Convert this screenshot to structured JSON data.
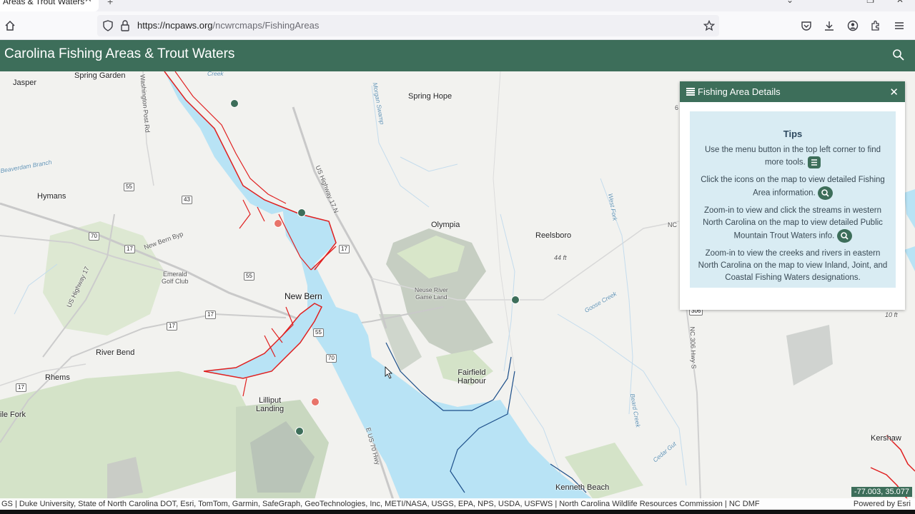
{
  "browser": {
    "tab_title": "Areas & Trout Waters",
    "url_host": "https://ncpaws.org",
    "url_path": "/ncwrcmaps/FishingAreas"
  },
  "app": {
    "title": "Carolina Fishing Areas & Trout Waters"
  },
  "map": {
    "labels": {
      "jasper": "Jasper",
      "spring_garden": "Spring Garden",
      "spring_hope": "Spring Hope",
      "hymans": "Hymans",
      "olympia": "Olympia",
      "reelsboro": "Reelsboro",
      "emerald": "Emerald\nGolf Club",
      "new_bern": "New Bern",
      "river_bend": "River Bend",
      "rhems": "Rhems",
      "fairfield": "Fairfield\nHarbour",
      "lilliput": "Lilliput\nLanding",
      "kenneth": "Kenneth Beach",
      "kershaw": "Kershaw",
      "file_fork": "ile Fork",
      "neuse_game": "Neuse River\nGame Land",
      "beaverdam": "Beaverdam Branch",
      "us17n": "US Highway 17 N",
      "us17": "US Highway 17",
      "new_bern_byp": "New Bern Byp",
      "washington_post": "Washington Post Rd",
      "morgan_swamp": "Morgan Swamp",
      "west_fork": "West Fork",
      "goose_creek": "Goose Creek",
      "e_us70": "E US 70 Hwy",
      "nc306": "NC 306 Hwy S",
      "beard_creek": "Beard Creek",
      "cedar_gut": "Cedar Gut",
      "creek": "Creek",
      "ft44": "44 ft",
      "ft10": "10 ft",
      "nc_edge": "NC",
      "ft6": "6"
    },
    "shields": [
      "55",
      "43",
      "70",
      "17",
      "55",
      "17",
      "17",
      "17",
      "55",
      "70",
      "17",
      "306"
    ]
  },
  "panel": {
    "title": "Fishing Area Details",
    "tips_title": "Tips",
    "tip1": "Use the menu button in the top left corner to find more tools.",
    "tip2": "Click the icons on the map to view detailed Fishing Area information.",
    "tip3": "Zoom-in to view and click the streams in western North Carolina on the map to view detailed Public Mountain Trout Waters info.",
    "tip4": "Zoom-in to view the creeks and rivers in eastern North Carolina on the map to view Inland, Joint, and Coastal Fishing Waters designations."
  },
  "footer": {
    "attribution": "GS | Duke University, State of North Carolina DOT, Esri, TomTom, Garmin, SafeGraph, GeoTechnologies, Inc, METI/NASA, USGS, EPA, NPS, USDA, USFWS | North Carolina Wildlife Resources Commission | NC DMF",
    "powered": "Powered by Esri",
    "coords": "-77.003, 35.077"
  },
  "colors": {
    "header": "#3d6e5a",
    "water": "#b8e3f5",
    "fishing_outline": "#e02020",
    "marker_green": "#3d6e5a",
    "marker_red": "#e8746a"
  }
}
